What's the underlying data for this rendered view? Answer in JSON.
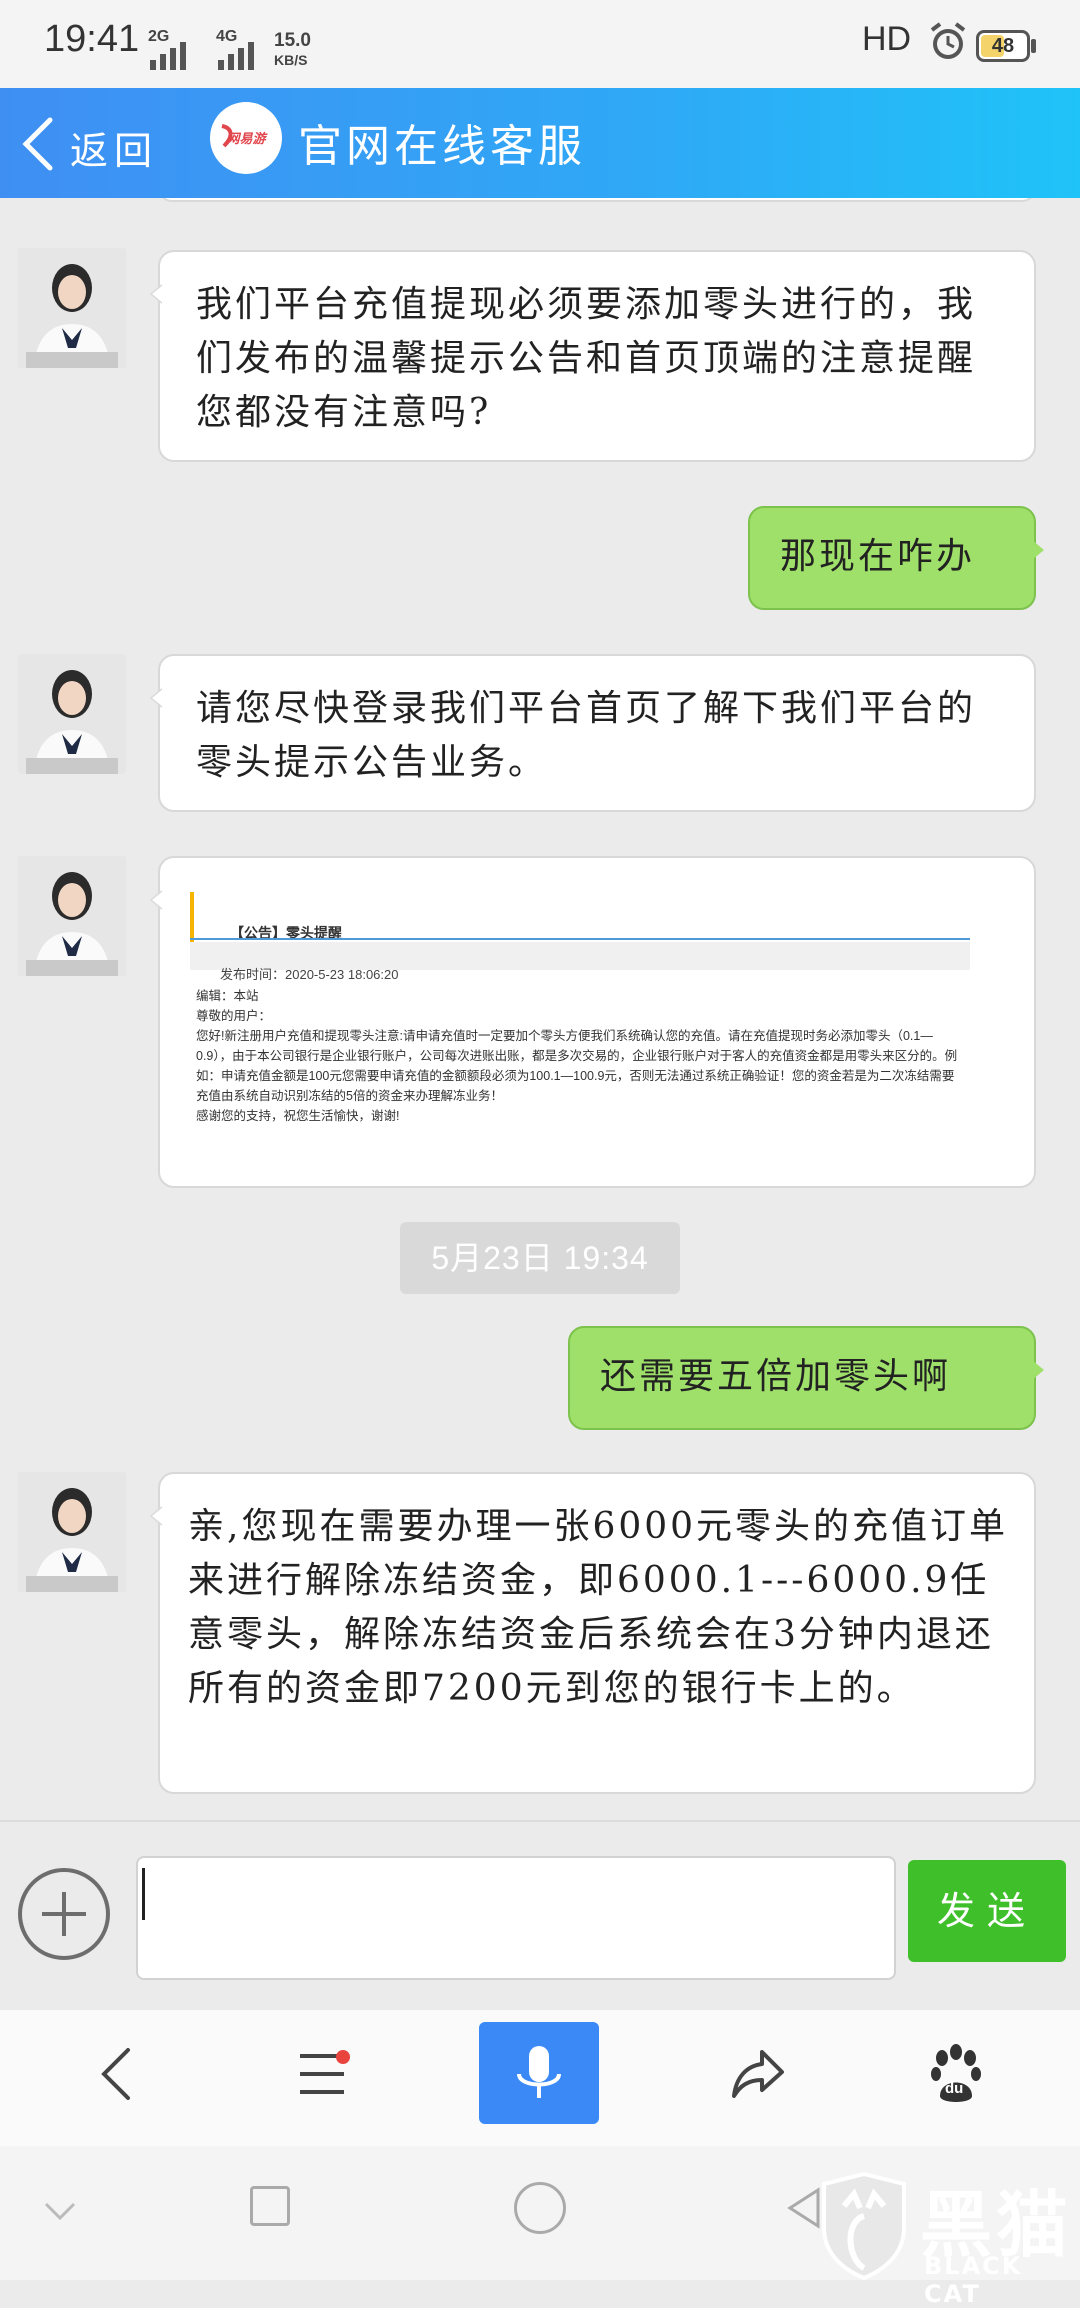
{
  "status_bar": {
    "time": "19:41",
    "sim1": "2G",
    "sim2": "4G",
    "speed_value": "15.0",
    "speed_unit": "KB/S",
    "hd": "HD",
    "battery": "48"
  },
  "header": {
    "back_label": "返回",
    "logo_text": "网易游",
    "title": "官网在线客服"
  },
  "messages": [
    {
      "from": "agent",
      "type": "text",
      "text": "我们平台充值提现必须要添加零头进行的，我们发布的温馨提示公告和首页顶端的注意提醒您都没有注意吗?"
    },
    {
      "from": "user",
      "type": "text",
      "text": "那现在咋办"
    },
    {
      "from": "agent",
      "type": "text",
      "text": "请您尽快登录我们平台首页了解下我们平台的零头提示公告业务。"
    },
    {
      "from": "agent",
      "type": "image"
    },
    {
      "from": "user",
      "type": "text",
      "text": "还需要五倍加零头啊"
    },
    {
      "from": "agent",
      "type": "text",
      "text": "亲,您现在需要办理一张6000元零头的充值订单来进行解除冻结资金，即6000.1---6000.9任意零头，解除冻结资金后系统会在3分钟内退还所有的资金即7200元到您的银行卡上的。"
    }
  ],
  "notice_image": {
    "title": "【公告】零头提醒",
    "date": "发布时间：2020-5-23 18:06:20",
    "editor": "编辑：本站",
    "greeting": "尊敬的用户：",
    "body": "您好!新注册用户充值和提现零头注意:请申请充值时一定要加个零头方便我们系统确认您的充值。请在充值提现时务必添加零头（0.1—0.9），由于本公司银行是企业银行账户，公司每次进账出账，都是多次交易的，企业银行账户对于客人的充值资金都是用零头来区分的。例如：申请充值金额是100元您需要申请充值的金额额段必须为100.1—100.9元，否则无法通过系统正确验证！您的资金若是为二次冻结需要充值由系统自动识别冻结的5倍的资金来办理解冻业务！",
    "closing": "感谢您的支持，祝您生活愉快，谢谢!"
  },
  "timestamp": "5月23日 19:34",
  "input": {
    "value": "",
    "send_label": "发送"
  },
  "toolbar": {
    "items": [
      "back",
      "menu",
      "voice",
      "share",
      "baidu"
    ],
    "baidu_label": "du"
  },
  "watermark": {
    "text": "黑猫",
    "sub": "BLACK CAT"
  },
  "colors": {
    "header_start": "#3f8ff3",
    "header_end": "#1fc3f8",
    "user_bubble": "#9fe06a",
    "send_button": "#3fc02b",
    "mic_button": "#3a89f7"
  }
}
